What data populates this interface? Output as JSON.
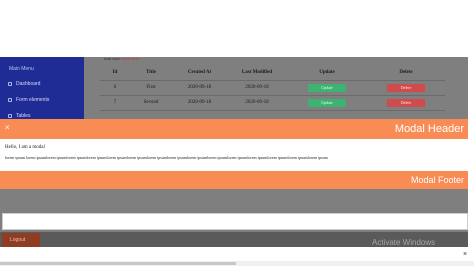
{
  "sidebar": {
    "header": "Main Menu",
    "items": [
      {
        "label": "Dashboard"
      },
      {
        "label": "Form elements"
      },
      {
        "label": "Tables"
      }
    ],
    "logout_label": "Logout"
  },
  "content": {
    "caption_prefix": "Add user: ",
    "caption_link": "click here"
  },
  "table": {
    "headers": [
      "Id",
      "Title",
      "Created At",
      "Last Modified",
      "Update",
      "Delete"
    ],
    "rows": [
      {
        "id": "6",
        "title": "First",
        "created": "2020-09-18",
        "modified": "2020-09-18",
        "update": "Update",
        "delete": "Delete"
      },
      {
        "id": "7",
        "title": "Second",
        "created": "2020-09-18",
        "modified": "2020-09-18",
        "update": "Update",
        "delete": "Delete"
      }
    ]
  },
  "modal": {
    "close_glyph": "×",
    "header_title": "Modal Header",
    "greeting": "Hello, I am a modal",
    "body_text": "lorem ipsum lorem ipsumlorem ipsumlorem ipsumlorem ipsumlorem ipsumlorem ipsumlorem ipsumlorem ipsumlorem ipsumlorem ipsumlorem ipsumlorem ipsumlorem ipsumlorem ipsumlorem ipsum",
    "footer_title": "Modal Footer"
  },
  "watermark": "Activate Windows",
  "bottom_close_glyph": "×",
  "colors": {
    "sidebar": "#1f2c95",
    "modal_accent": "#f98c55",
    "update_button": "#3cb371",
    "delete_button": "#d04b4b",
    "logout_button": "#8e3c22"
  }
}
